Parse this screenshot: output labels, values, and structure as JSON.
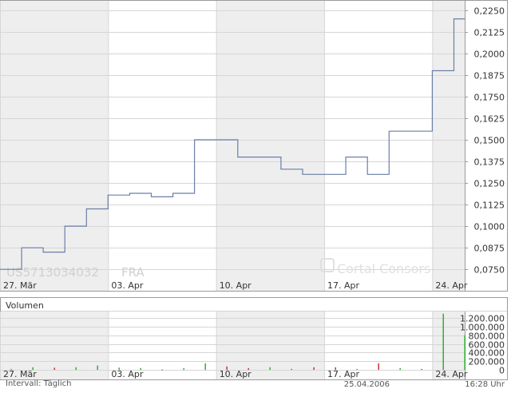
{
  "price_chart": {
    "watermark_isin": "US5713034032",
    "watermark_exchange": "FRA",
    "brand": "Cortal Consors"
  },
  "volume_chart": {
    "title": "Volumen"
  },
  "footer": {
    "interval": "Intervall: Täglich",
    "date": "25.04.2006",
    "time": "16:28 Uhr"
  },
  "colors": {
    "price_line": "#6b7fa8",
    "shade": "#eeeeee",
    "grid": "#d6d6d6",
    "frame": "#9a9a9a",
    "volume_up": "#22aa22",
    "volume_down": "#cc2222"
  },
  "chart_data": [
    {
      "type": "line",
      "step": true,
      "x": [
        "27.03.",
        "28.03.",
        "29.03.",
        "30.03.",
        "31.03.",
        "03.04.",
        "04.04.",
        "05.04.",
        "06.04.",
        "07.04.",
        "10.04.",
        "11.04.",
        "12.04.",
        "13.04.",
        "14.04.",
        "17.04.",
        "18.04.",
        "19.04.",
        "20.04.",
        "21.04.",
        "24.04.",
        "25.04."
      ],
      "values": [
        0.075,
        0.0875,
        0.085,
        0.1,
        0.11,
        0.118,
        0.119,
        0.117,
        0.119,
        0.15,
        0.15,
        0.14,
        0.14,
        0.133,
        0.13,
        0.13,
        0.14,
        0.13,
        0.155,
        0.155,
        0.19,
        0.22
      ],
      "x_tick_labels": [
        "27. Mär",
        "03. Apr",
        "10. Apr",
        "17. Apr",
        "24. Apr"
      ],
      "y_tick_labels": [
        "0,0750",
        "0,0875",
        "0,1000",
        "0,1125",
        "0,1250",
        "0,1375",
        "0,1500",
        "0,1625",
        "0,1750",
        "0,1875",
        "0,2000",
        "0,2125",
        "0,2250"
      ],
      "y_ticks": [
        0.075,
        0.0875,
        0.1,
        0.1125,
        0.125,
        0.1375,
        0.15,
        0.1625,
        0.175,
        0.1875,
        0.2,
        0.2125,
        0.225
      ],
      "ylim": [
        0.07,
        0.23
      ],
      "grid": true
    },
    {
      "type": "bar",
      "title": "Volumen",
      "x": [
        "27.03.",
        "28.03.",
        "29.03.",
        "30.03.",
        "31.03.",
        "03.04.",
        "04.04.",
        "05.04.",
        "06.04.",
        "07.04.",
        "10.04.",
        "11.04.",
        "12.04.",
        "13.04.",
        "14.04.",
        "17.04.",
        "18.04.",
        "19.04.",
        "20.04.",
        "21.04.",
        "24.04.",
        "25.04."
      ],
      "values": [
        20000,
        60000,
        50000,
        60000,
        100000,
        50000,
        40000,
        10000,
        40000,
        150000,
        80000,
        40000,
        60000,
        20000,
        60000,
        60000,
        20000,
        150000,
        40000,
        20000,
        1300000,
        800000
      ],
      "directions": [
        "up",
        "up",
        "down",
        "up",
        "up",
        "up",
        "up",
        "down",
        "up",
        "up",
        "down",
        "down",
        "up",
        "down",
        "down",
        "down",
        "up",
        "down",
        "up",
        "down",
        "up",
        "up"
      ],
      "x_tick_labels": [
        "27. Mär",
        "03. Apr",
        "10. Apr",
        "17. Apr",
        "24. Apr"
      ],
      "y_tick_labels": [
        "1.200.000",
        "1.000.000",
        "800.000",
        "600.000",
        "400.000",
        "200.000",
        "0"
      ],
      "y_ticks": [
        1200000,
        1000000,
        800000,
        600000,
        400000,
        200000,
        0
      ],
      "ylim": [
        0,
        1350000
      ],
      "grid": true
    }
  ]
}
